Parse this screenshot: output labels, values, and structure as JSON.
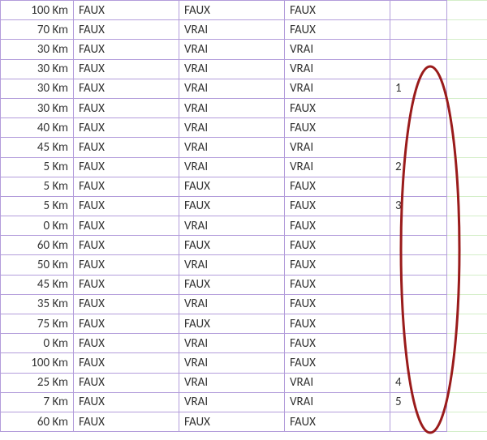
{
  "table": {
    "rows": [
      {
        "km": "100 Km",
        "a": "FAUX",
        "b": "FAUX",
        "c": "FAUX",
        "n": ""
      },
      {
        "km": "70 Km",
        "a": "FAUX",
        "b": "VRAI",
        "c": "FAUX",
        "n": ""
      },
      {
        "km": "30 Km",
        "a": "FAUX",
        "b": "VRAI",
        "c": "VRAI",
        "n": ""
      },
      {
        "km": "30 Km",
        "a": "FAUX",
        "b": "VRAI",
        "c": "VRAI",
        "n": ""
      },
      {
        "km": "30 Km",
        "a": "FAUX",
        "b": "VRAI",
        "c": "VRAI",
        "n": "1"
      },
      {
        "km": "30 Km",
        "a": "FAUX",
        "b": "VRAI",
        "c": "FAUX",
        "n": ""
      },
      {
        "km": "40 Km",
        "a": "FAUX",
        "b": "VRAI",
        "c": "FAUX",
        "n": ""
      },
      {
        "km": "45 Km",
        "a": "FAUX",
        "b": "VRAI",
        "c": "VRAI",
        "n": ""
      },
      {
        "km": "5 Km",
        "a": "FAUX",
        "b": "VRAI",
        "c": "VRAI",
        "n": "2"
      },
      {
        "km": "5 Km",
        "a": "FAUX",
        "b": "FAUX",
        "c": "FAUX",
        "n": ""
      },
      {
        "km": "5 Km",
        "a": "FAUX",
        "b": "FAUX",
        "c": "FAUX",
        "n": "3"
      },
      {
        "km": "0 Km",
        "a": "FAUX",
        "b": "VRAI",
        "c": "FAUX",
        "n": ""
      },
      {
        "km": "60 Km",
        "a": "FAUX",
        "b": "FAUX",
        "c": "FAUX",
        "n": ""
      },
      {
        "km": "50 Km",
        "a": "FAUX",
        "b": "VRAI",
        "c": "FAUX",
        "n": ""
      },
      {
        "km": "45 Km",
        "a": "FAUX",
        "b": "FAUX",
        "c": "FAUX",
        "n": ""
      },
      {
        "km": "35 Km",
        "a": "FAUX",
        "b": "VRAI",
        "c": "FAUX",
        "n": ""
      },
      {
        "km": "75 Km",
        "a": "FAUX",
        "b": "FAUX",
        "c": "FAUX",
        "n": ""
      },
      {
        "km": "0 Km",
        "a": "FAUX",
        "b": "VRAI",
        "c": "FAUX",
        "n": ""
      },
      {
        "km": "100 Km",
        "a": "FAUX",
        "b": "VRAI",
        "c": "FAUX",
        "n": ""
      },
      {
        "km": "25 Km",
        "a": "FAUX",
        "b": "VRAI",
        "c": "VRAI",
        "n": "4"
      },
      {
        "km": "7 Km",
        "a": "FAUX",
        "b": "VRAI",
        "c": "VRAI",
        "n": "5"
      },
      {
        "km": "60 Km",
        "a": "FAUX",
        "b": "FAUX",
        "c": "FAUX",
        "n": ""
      }
    ]
  },
  "annotation": {
    "shape": "ellipse",
    "color": "#9a1b1b",
    "strokeWidth": 3
  }
}
